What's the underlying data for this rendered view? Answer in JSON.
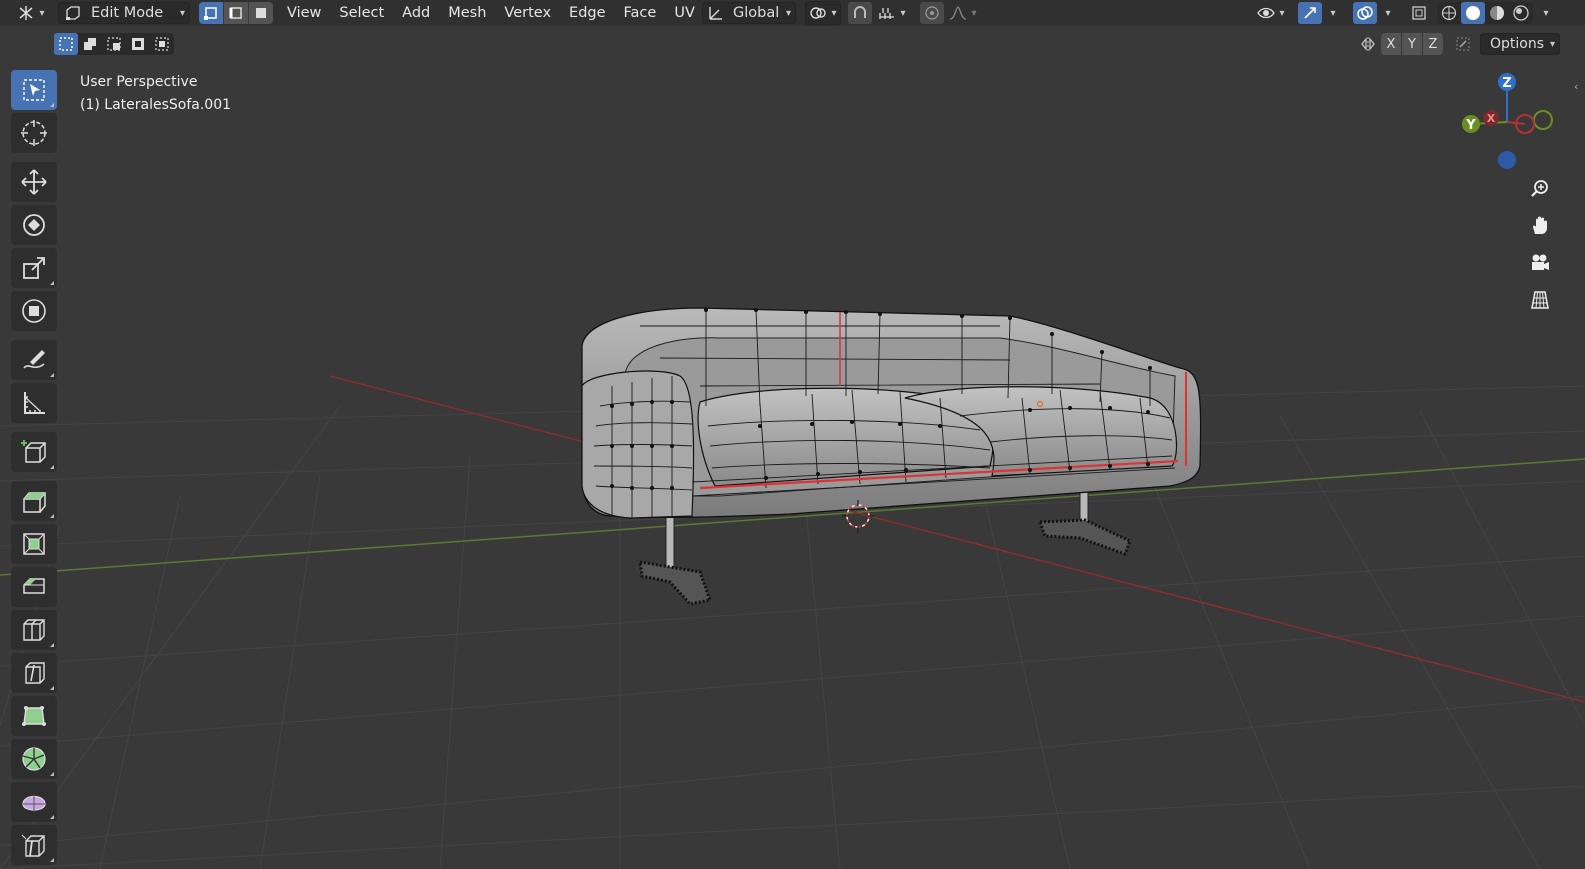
{
  "header": {
    "mode": "Edit Mode",
    "menus": [
      "View",
      "Select",
      "Add",
      "Mesh",
      "Vertex",
      "Edge",
      "Face",
      "UV"
    ],
    "orientation": "Global"
  },
  "subheader": {
    "axes": [
      "X",
      "Y",
      "Z"
    ],
    "options_label": "Options"
  },
  "viewport": {
    "view_name": "User Perspective",
    "object_name": "(1) LateralesSofa.001"
  },
  "gizmo": {
    "z": "Z",
    "y": "Y",
    "x": "X"
  },
  "colors": {
    "accent": "#4772b3",
    "axis_x": "#b33333",
    "axis_y": "#6b8e23",
    "axis_z": "#2f6fd0"
  },
  "icons": [
    "editor-type-icon",
    "mode-icon",
    "vertex-select-icon",
    "edge-select-icon",
    "face-select-icon",
    "transform-orientation-icon",
    "pivot-icon",
    "snap-icon",
    "snap-increment-icon",
    "proportional-edit-icon",
    "falloff-icon",
    "visibility-icon",
    "gizmo-icon",
    "overlay-icon",
    "xray-icon",
    "wireframe-shading-icon",
    "solid-shading-icon",
    "material-shading-icon",
    "rendered-shading-icon",
    "zoom-icon",
    "hand-icon",
    "camera-icon",
    "grid-icon"
  ]
}
